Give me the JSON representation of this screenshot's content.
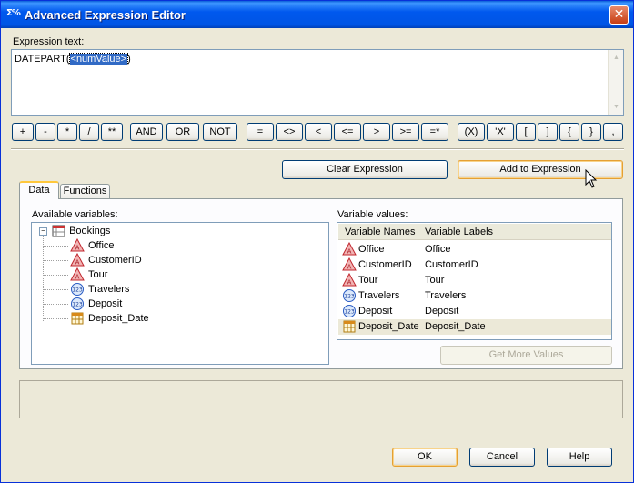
{
  "window": {
    "title": "Advanced Expression Editor",
    "close_label": "✕"
  },
  "expression": {
    "label": "Expression text:",
    "prefix": "DATEPART(",
    "selected_token": "<numValue>",
    "suffix": ")"
  },
  "operators": [
    "+",
    "-",
    "*",
    "/",
    "**",
    "AND",
    "OR",
    "NOT",
    "=",
    "<>",
    "<",
    "<=",
    ">",
    ">=",
    "=*",
    "(X)",
    "'X'",
    "[",
    "]",
    "{",
    "}",
    ","
  ],
  "actions": {
    "clear": "Clear Expression",
    "add": "Add to Expression"
  },
  "tabs": [
    {
      "label": "Data",
      "active": true
    },
    {
      "label": "Functions",
      "active": false
    }
  ],
  "available": {
    "label": "Available variables:",
    "root": {
      "name": "Bookings",
      "icon": "table-icon"
    },
    "variables": [
      {
        "name": "Office",
        "icon": "character-var-icon"
      },
      {
        "name": "CustomerID",
        "icon": "character-var-icon"
      },
      {
        "name": "Tour",
        "icon": "character-var-icon"
      },
      {
        "name": "Travelers",
        "icon": "numeric-var-icon"
      },
      {
        "name": "Deposit",
        "icon": "numeric-var-icon"
      },
      {
        "name": "Deposit_Date",
        "icon": "date-var-icon"
      }
    ]
  },
  "values": {
    "label": "Variable values:",
    "columns": [
      "Variable Names",
      "Variable Labels"
    ],
    "rows": [
      {
        "name": "Office",
        "label": "Office",
        "icon": "character-var-icon"
      },
      {
        "name": "CustomerID",
        "label": "CustomerID",
        "icon": "character-var-icon"
      },
      {
        "name": "Tour",
        "label": "Tour",
        "icon": "character-var-icon"
      },
      {
        "name": "Travelers",
        "label": "Travelers",
        "icon": "numeric-var-icon"
      },
      {
        "name": "Deposit",
        "label": "Deposit",
        "icon": "numeric-var-icon"
      },
      {
        "name": "Deposit_Date",
        "label": "Deposit_Date",
        "icon": "date-var-icon",
        "selected": true
      }
    ],
    "more_button": "Get More Values"
  },
  "footer": {
    "ok": "OK",
    "cancel": "Cancel",
    "help": "Help"
  },
  "colors": {
    "titlebar": "#0055e5",
    "selection": "#316ac5",
    "focus_border": "#e5a033"
  }
}
